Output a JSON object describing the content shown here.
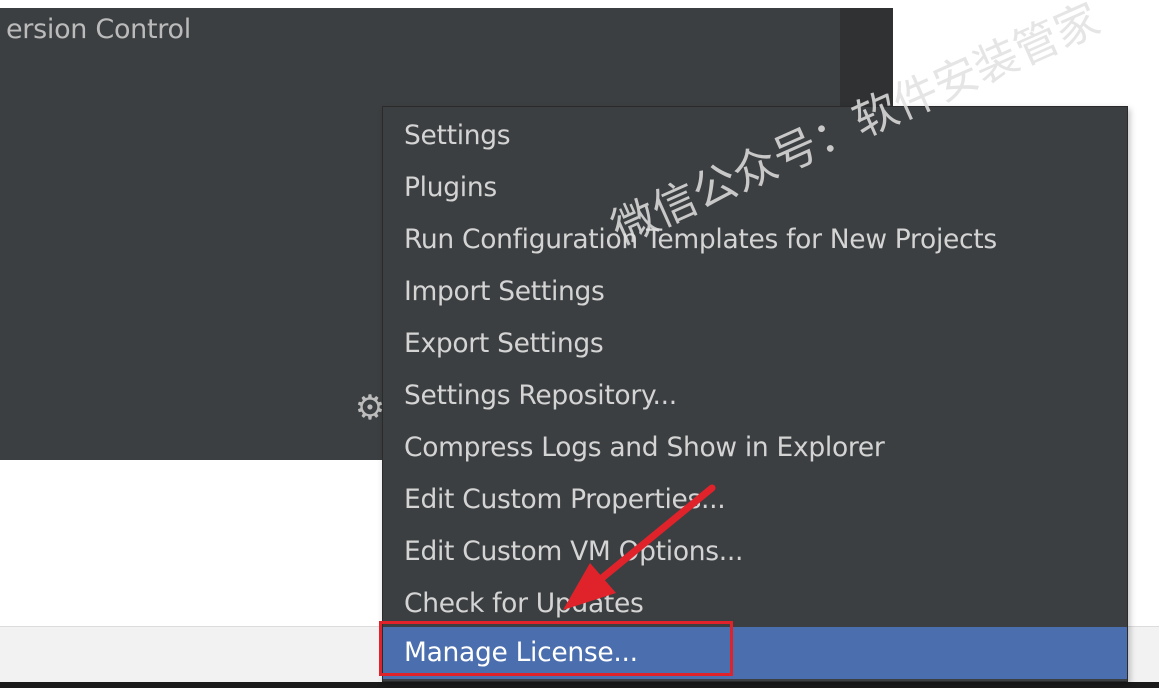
{
  "dialog": {
    "header_text": "ersion Control"
  },
  "menu": {
    "items": [
      {
        "label": "Settings"
      },
      {
        "label": "Plugins"
      },
      {
        "label": "Run Configuration Templates for New Projects"
      },
      {
        "label": "Import Settings"
      },
      {
        "label": "Export Settings"
      },
      {
        "label": "Settings Repository..."
      },
      {
        "label": "Compress Logs and Show in Explorer"
      },
      {
        "label": "Edit Custom Properties..."
      },
      {
        "label": "Edit Custom VM Options..."
      },
      {
        "label": "Check for Updates"
      },
      {
        "label": "Manage License...",
        "selected": true
      }
    ]
  },
  "icons": {
    "settings": "gear-icon"
  },
  "watermark": {
    "text": "微信公众号：软件安装管家"
  },
  "colors": {
    "dialog_bg": "#3c3f41",
    "selection": "#4b6eaf",
    "annotation_red": "#e0232b"
  }
}
